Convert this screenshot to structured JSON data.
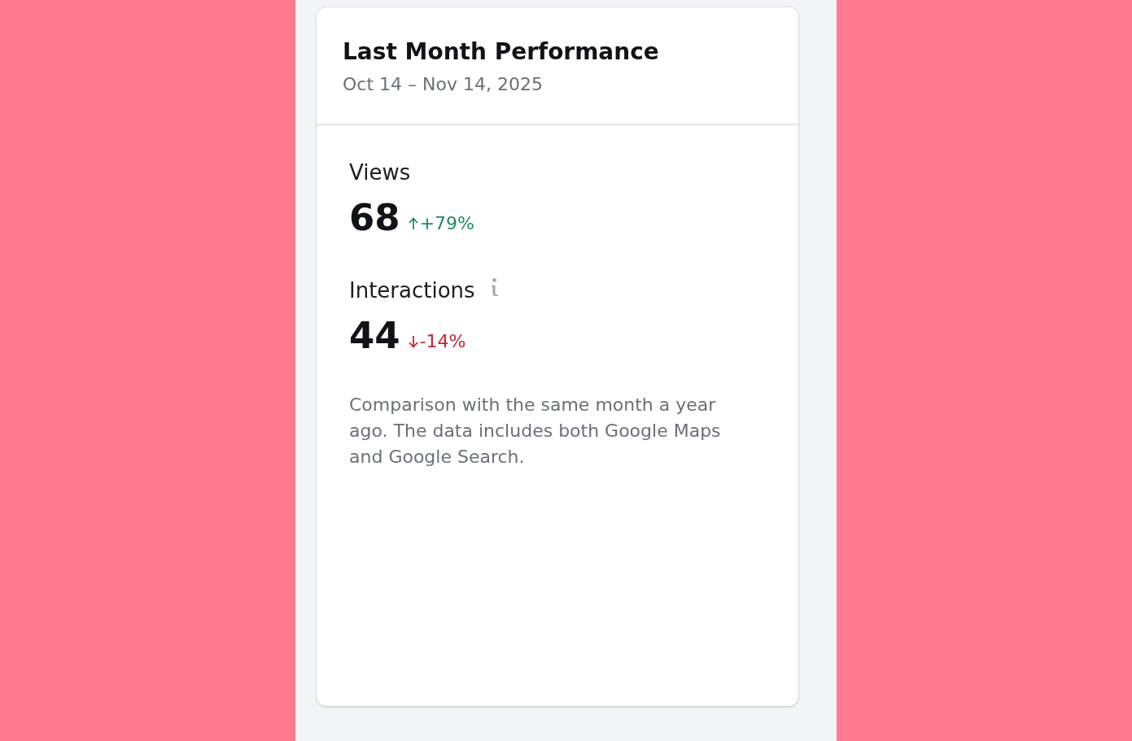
{
  "card": {
    "title": "Last Month Performance",
    "date_range": "Oct 14 – Nov 14, 2025",
    "metrics": [
      {
        "label": "Views",
        "info": false,
        "value": "68",
        "change": "+79%",
        "rising": true
      },
      {
        "label": "Interactions",
        "info": true,
        "value": "44",
        "change": "-14%",
        "rising": false
      }
    ],
    "note": "Comparison with the same month a year ago. The data includes both Google Maps and Google Search."
  }
}
